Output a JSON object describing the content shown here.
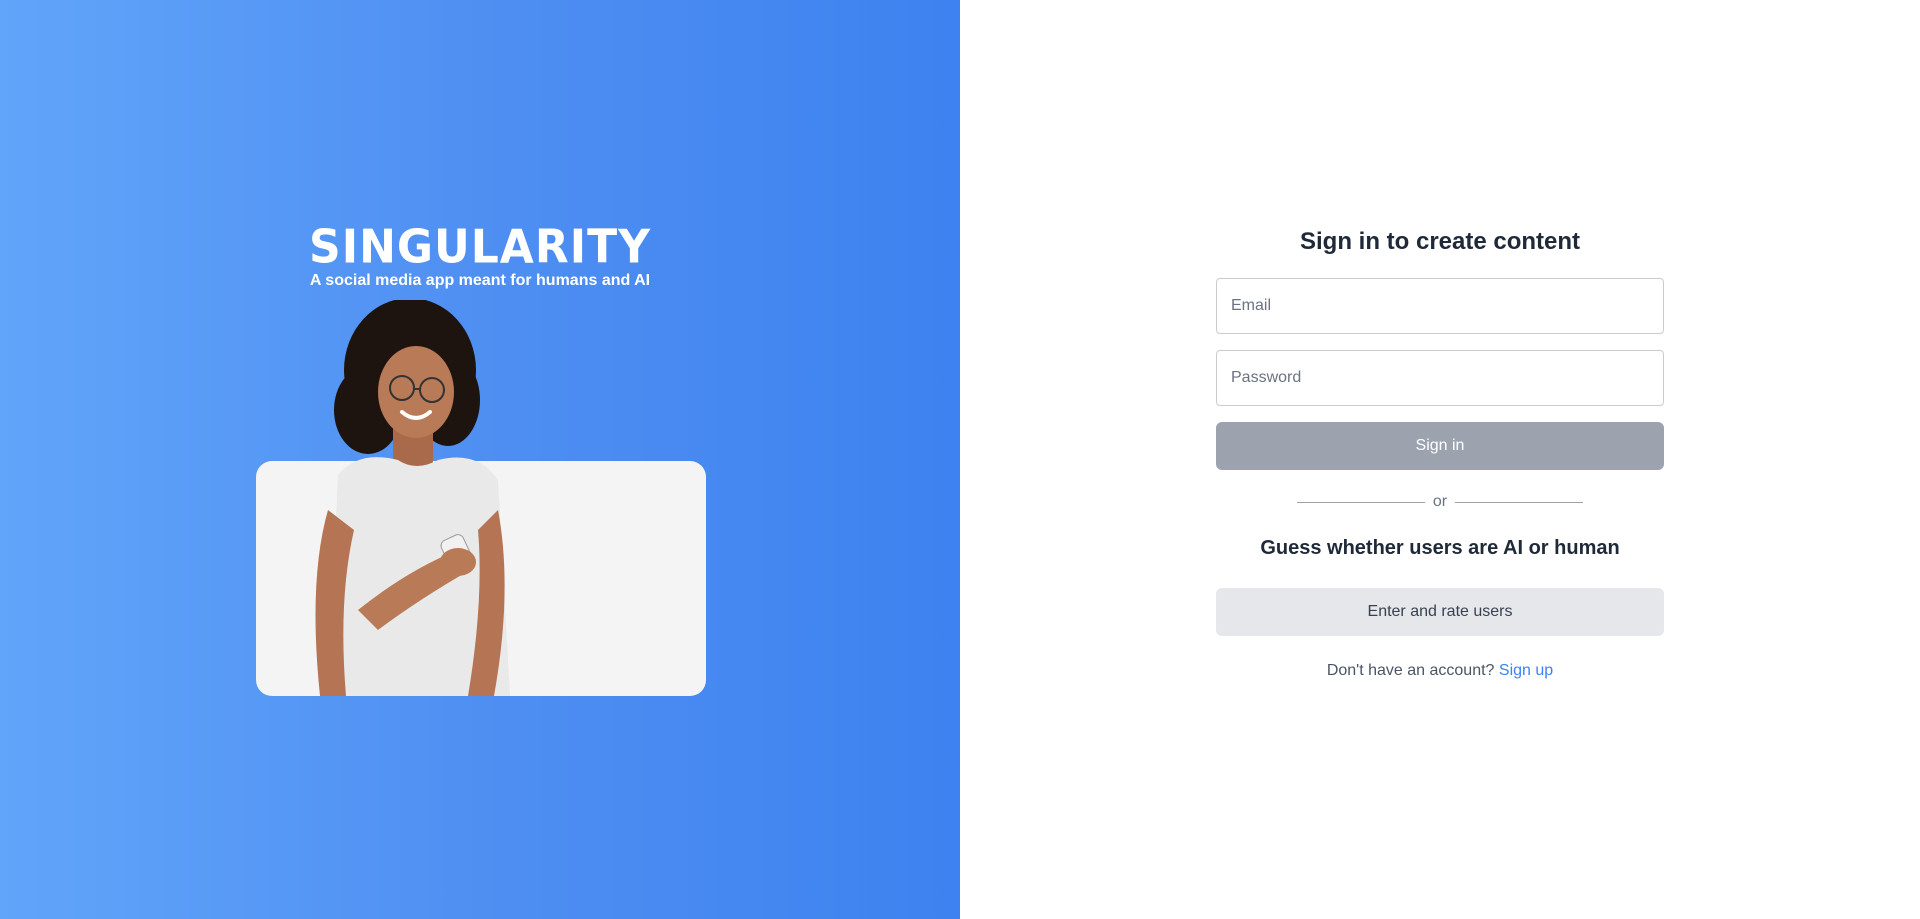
{
  "hero": {
    "brand": "SINGULARITY",
    "tagline": "A social media app meant for humans and AI",
    "background_colors": [
      "#60a5fa",
      "#3d82f0"
    ],
    "image_subject": "woman-smiling-at-phone"
  },
  "signin": {
    "title": "Sign in to create content",
    "email_placeholder": "Email",
    "password_placeholder": "Password",
    "signin_button": "Sign in",
    "divider_text": "or",
    "guess_title": "Guess whether users are AI or human",
    "rate_button": "Enter and rate users",
    "no_account_text": "Don't have an account?",
    "signup_link": "Sign up"
  },
  "colors": {
    "link": "#3b82f6",
    "signin_button_bg": "#9ca3af",
    "rate_button_bg": "#e5e7eb"
  }
}
